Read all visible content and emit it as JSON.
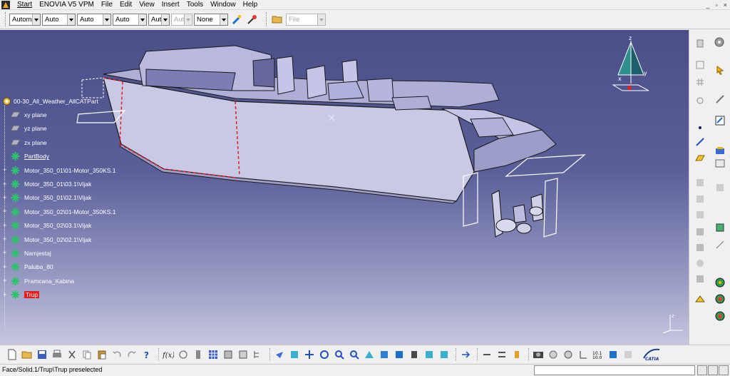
{
  "menu": {
    "items": [
      "Start",
      "ENOVIA V5 VPM",
      "File",
      "Edit",
      "View",
      "Insert",
      "Tools",
      "Window",
      "Help"
    ],
    "window_controls": [
      "_",
      "▫",
      "×"
    ]
  },
  "toolbar_top": {
    "combos": [
      "Automa",
      "Auto",
      "Auto",
      "Auto",
      "Aut",
      "Aut",
      "None"
    ],
    "file_combo": "File"
  },
  "tree": {
    "root": "00-30_All_Weather_AllCATPart",
    "items": [
      {
        "label": "xy plane",
        "type": "plane"
      },
      {
        "label": "yz plane",
        "type": "plane"
      },
      {
        "label": "zx plane",
        "type": "plane"
      },
      {
        "label": "PartBody",
        "type": "body"
      },
      {
        "label": "Motor_350_01\\01-Motor_350KS.1",
        "type": "part"
      },
      {
        "label": "Motor_350_01\\03.1\\Vijak",
        "type": "part"
      },
      {
        "label": "Motor_350_01\\02.1\\Vijak",
        "type": "part"
      },
      {
        "label": "Motor_350_02\\01-Motor_350KS.1",
        "type": "part"
      },
      {
        "label": "Motor_350_02\\03.1\\Vijak",
        "type": "part"
      },
      {
        "label": "Motor_350_02\\02.1\\Vijak",
        "type": "part"
      },
      {
        "label": "Namjestaj",
        "type": "part"
      },
      {
        "label": "Paluba_80",
        "type": "part"
      },
      {
        "label": "Pramcana_Kabina",
        "type": "part"
      },
      {
        "label": "Trup",
        "type": "part",
        "selected": true
      }
    ]
  },
  "status": {
    "text": "Face/Solid.1/Trup\\Trup preselected"
  },
  "colors": {
    "viewport_top": "#4a4f88",
    "viewport_bottom": "#c6c7df",
    "selection": "#e41e1e",
    "hull": "#c9c9e6"
  }
}
